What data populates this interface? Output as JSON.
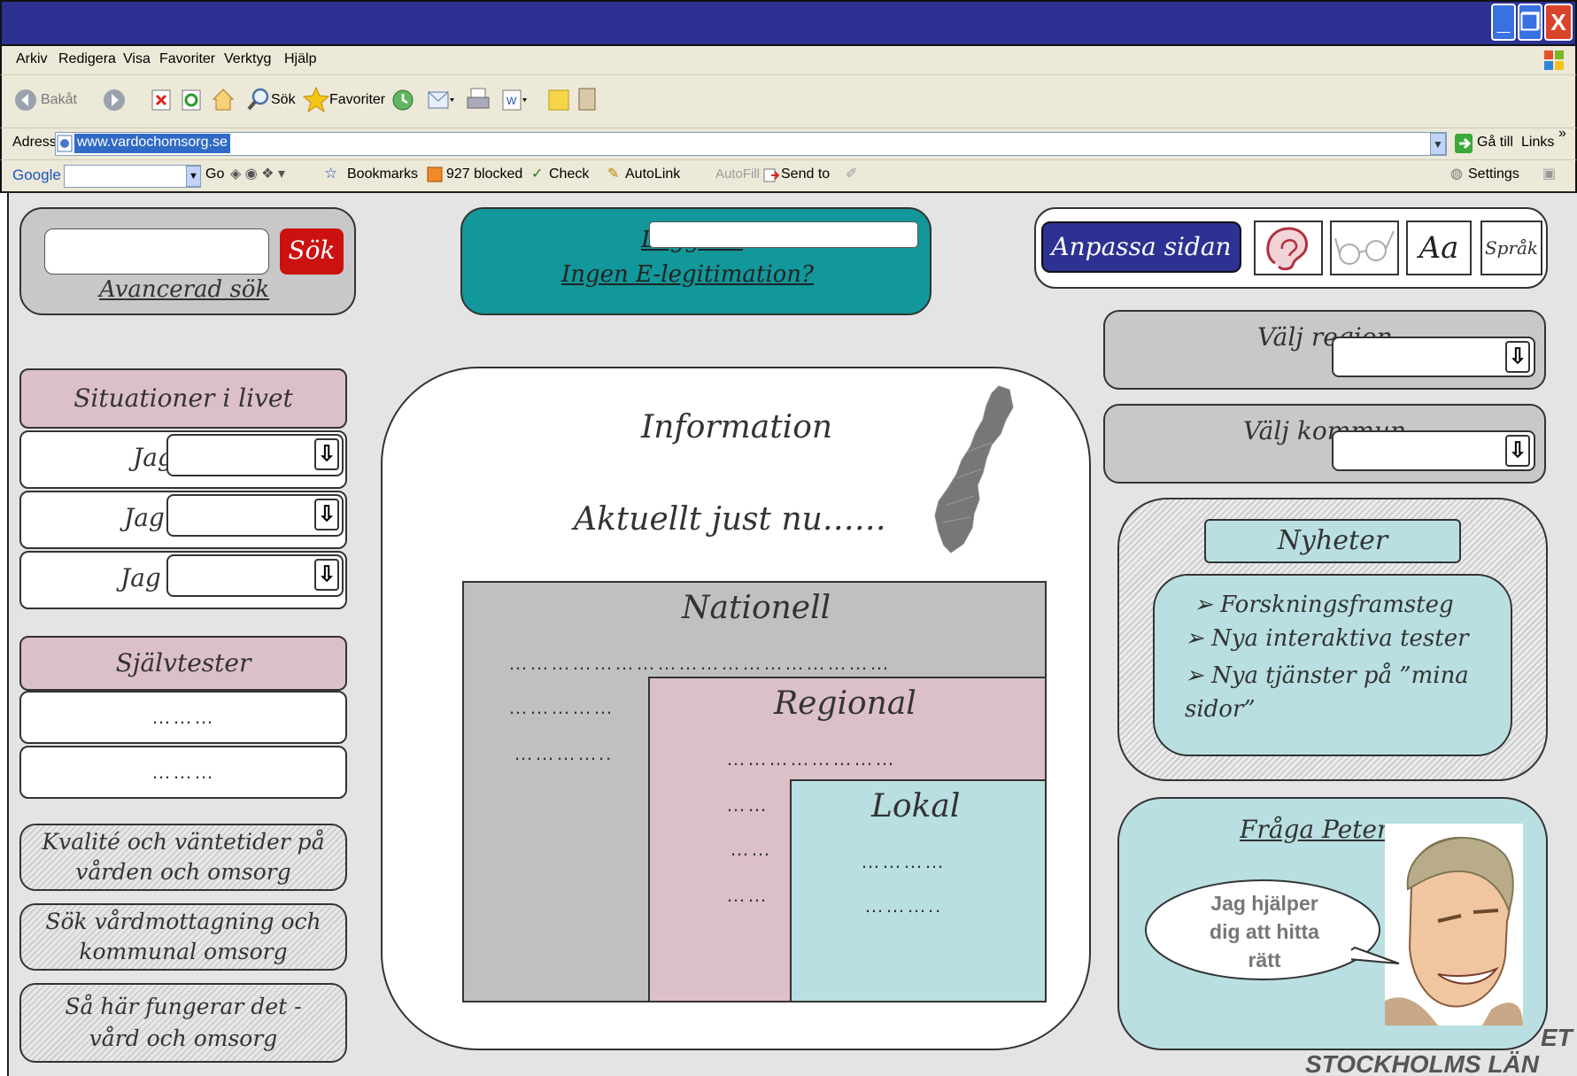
{
  "browser": {
    "menu": [
      "Arkiv",
      "Redigera",
      "Visa",
      "Favoriter",
      "Verktyg",
      "Hjälp"
    ],
    "toolbar": {
      "back": "Bakåt",
      "search": "Sök",
      "favorites": "Favoriter"
    },
    "address": {
      "label": "Adress",
      "url": "www.vardochomsorg.se",
      "go": "Gå till",
      "links": "Links"
    },
    "google_bar": {
      "logo": "Google",
      "go": "Go",
      "bookmarks": "Bookmarks",
      "blocked": "927 blocked",
      "check": "Check",
      "autolink": "AutoLink",
      "autofill": "AutoFill",
      "send_to": "Send to",
      "settings": "Settings"
    }
  },
  "search": {
    "button": "Sök",
    "advanced": "Avancerad sök"
  },
  "login": {
    "link": "Logga in",
    "no_eid": "Ingen E-legitimation?"
  },
  "accessibility": {
    "customize": "Anpassa sidan",
    "text_size": "Aa",
    "language": "Språk"
  },
  "region": {
    "region_label": "Välj region",
    "kommun_label": "Välj kommun"
  },
  "left": {
    "situations_title": "Situationer i livet",
    "situation_rows": [
      "Jag",
      "Jag",
      "Jag"
    ],
    "selftests_title": "Självtester",
    "selftest_rows": [
      "………",
      "………"
    ],
    "links": [
      "Kvalité och väntetider på vården och omsorg",
      "Sök vårdmottagning och kommunal omsorg",
      "Så här fungerar det - vård och omsorg"
    ]
  },
  "center": {
    "title": "Information",
    "subtitle": "Aktuellt just nu……",
    "national": {
      "title": "Nationell",
      "lines": [
        "………………………………………………",
        "……………",
        "………….."
      ]
    },
    "regional": {
      "title": "Regional",
      "lines": [
        "……………………",
        "……",
        "……",
        "……"
      ]
    },
    "local": {
      "title": "Lokal",
      "lines": [
        "…………",
        "……….."
      ]
    }
  },
  "news": {
    "title": "Nyheter",
    "items": [
      "Forskningsframsteg",
      "Nya interaktiva tester",
      "Nya tjänster på ”mina sidor”"
    ]
  },
  "ask": {
    "title": "Fråga Peter",
    "bubble": "Jag hjälper dig att hitta rätt"
  },
  "footer": {
    "org_partial": "ET",
    "org": "STOCKHOLMS LÄN"
  },
  "colors": {
    "titlebar": "#2d3192",
    "teal": "#12979a",
    "pink": "#dcc0c8",
    "light_blue": "#b9dfe2",
    "grey": "#c8c8c8",
    "search_red": "#cc1111",
    "customize_blue": "#2d3192"
  },
  "icons": [
    "ear-icon",
    "glasses-icon",
    "back-arrow-icon",
    "forward-arrow-icon",
    "stop-icon",
    "refresh-icon",
    "home-icon",
    "search-icon",
    "star-icon",
    "history-icon",
    "mail-icon",
    "print-icon",
    "word-icon",
    "sweden-map"
  ]
}
